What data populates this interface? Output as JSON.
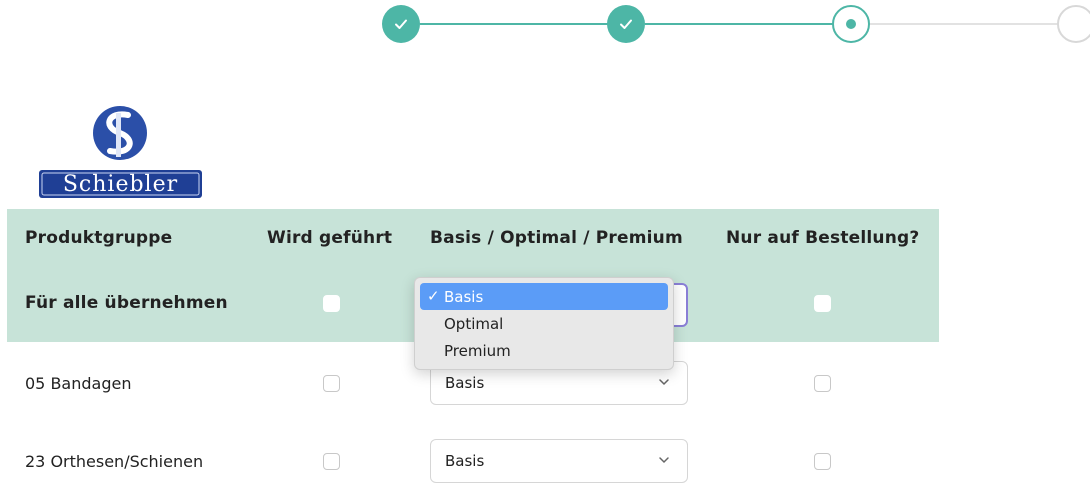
{
  "stepper": {
    "steps": [
      {
        "state": "done",
        "icon": "check-icon"
      },
      {
        "state": "done",
        "icon": "check-icon"
      },
      {
        "state": "active",
        "icon": "dot-icon"
      },
      {
        "state": "todo",
        "icon": ""
      }
    ],
    "colors": {
      "accent": "#4db6a6",
      "todo": "#d8d8d8"
    }
  },
  "logo": {
    "text": "Schiebler"
  },
  "table": {
    "headers": [
      "Produktgruppe",
      "Wird geführt",
      "Basis / Optimal / Premium",
      "Nur auf Bestellung?"
    ],
    "apply_all_label": "Für alle übernehmen",
    "rows": [
      {
        "name": "05 Bandagen",
        "level": "Basis"
      },
      {
        "name": "23 Orthesen/Schienen",
        "level": "Basis"
      }
    ],
    "band_color": "#c7e3d8"
  },
  "dropdown": {
    "options": [
      "Basis",
      "Optimal",
      "Premium"
    ],
    "selected": "Basis",
    "check": "✓",
    "highlight_color": "#5b9cf7"
  }
}
